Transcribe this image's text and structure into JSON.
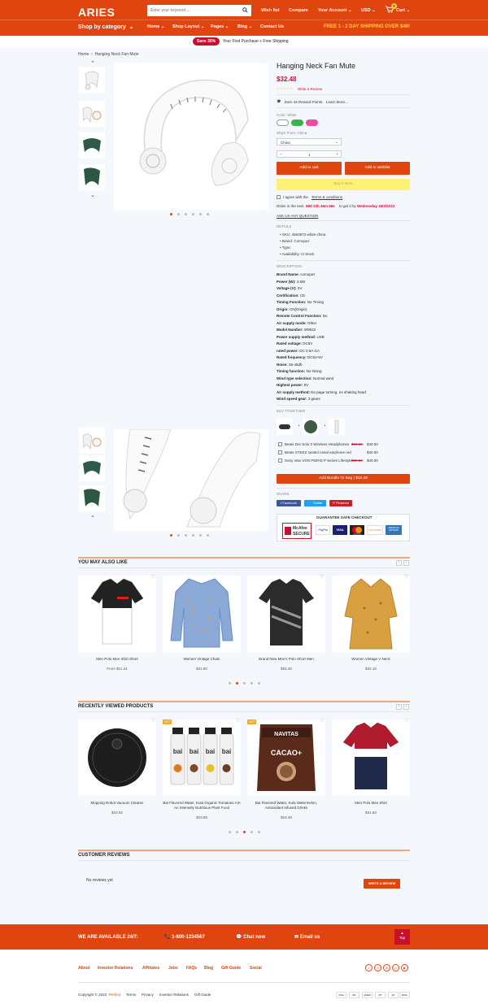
{
  "header": {
    "logo": "ARIES",
    "search_placeholder": "Enter your keyword ...",
    "wishlist": "Wish list",
    "compare": "Compare",
    "account": "Your Account",
    "currency": "USD",
    "cart": "Cart",
    "cart_count": "0",
    "shop_by_category": "Shop by category",
    "nav": [
      "Home",
      "Shop Layout",
      "Pages",
      "Blog",
      "Contact Us"
    ],
    "shipping": "FREE 1 - 2 DAY SHIPPING OVER $49!"
  },
  "promo": {
    "badge": "Save 30%",
    "text": "Your First Purchase + Free Shipping"
  },
  "breadcrumb": {
    "home": "Home",
    "current": "Hanging Neck Fan Mute"
  },
  "product": {
    "title": "Hanging Neck Fan Mute",
    "price": "$32.48",
    "review_link": "Write a Review",
    "reward": "Earn 16 Reward Points.",
    "learn_more": "Learn More...",
    "color_label": "Color: White",
    "ships_label": "Ships From: China",
    "ships_value": "China",
    "qty": "1",
    "add_to_cart": "Add to cart",
    "add_to_wishlist": "Add to wishlist",
    "buy_now": "Buy it Now",
    "agree_text": "I agree with the",
    "terms": "Terms & conditions",
    "order_prefix": "Order in the next",
    "countdown": "58d 23h 46m 56s",
    "order_mid": "to get it by",
    "delivery": "Wednesday 16/3/2022",
    "ask": "ASK US ANY QUESTION",
    "details_title": "DETAILS",
    "details": [
      "SKU: 4563972-white-china",
      "Brand: Comopez",
      "Type:",
      "Availability: In Stock"
    ],
    "description_title": "DESCRIPTION",
    "specs": [
      {
        "k": "Brand Name:",
        "v": "comopez"
      },
      {
        "k": "Power (W):",
        "v": "4.5W"
      },
      {
        "k": "Voltage (V):",
        "v": "5V"
      },
      {
        "k": "Certification:",
        "v": "CE"
      },
      {
        "k": "Timing Function:",
        "v": "No Timing"
      },
      {
        "k": "Origin:",
        "v": "CN(Origin)"
      },
      {
        "k": "Remote Control Function:",
        "v": "No"
      },
      {
        "k": "Air supply mode:",
        "v": "Other"
      },
      {
        "k": "Model Number:",
        "v": "W9042"
      },
      {
        "k": "Power supply method:",
        "v": "USB"
      },
      {
        "k": "Rated voltage:",
        "v": "DC5V"
      },
      {
        "k": "rated power:",
        "v": "DC 0.5A /1A"
      },
      {
        "k": "Rated frequency:",
        "v": "DC5V-5V"
      },
      {
        "k": "Noise:",
        "v": "36-45db"
      },
      {
        "k": "Timing function:",
        "v": "No timing"
      },
      {
        "k": "Wind type selection:",
        "v": "Normal wind"
      },
      {
        "k": "Highest power:",
        "v": "5V"
      },
      {
        "k": "Air supply method:",
        "v": "No page turning, no shaking head"
      },
      {
        "k": "Wind speed gear:",
        "v": "3 gears"
      }
    ],
    "buy_together_title": "BUY TOGETHER",
    "bundle": [
      {
        "name": "Beats Dre Solo 2 Wireless Headphones",
        "old": "$50.00",
        "new": "$40.00"
      },
      {
        "name": "Beats STEEZ sealed canal earphone red",
        "old": "",
        "new": "$40.00"
      },
      {
        "name": "Sony Vaio VGN P50HS P Series Lifestyle",
        "old": "$50.00",
        "new": "$40.00"
      }
    ],
    "bundle_button": "Add Bundle To Bag | $32.48",
    "share_title": "SHARE",
    "share": [
      "Facebook",
      "Twitter",
      "Pinterest"
    ],
    "guarantee": "GUARANTEE SAFE CHECKOUT",
    "mcafee_1": "McAfee",
    "mcafee_2": "SECURE",
    "payments": [
      "PayPal",
      "VISA",
      "mastercard",
      "DISCOVER",
      "AMERICAN EXPRESS"
    ]
  },
  "also_like": {
    "title": "YOU MAY ALSO LIKE",
    "items": [
      {
        "name": "Men Polo Men Shirt Short",
        "price": "From $11.24"
      },
      {
        "name": "Women Vintage Chain",
        "price": "$24.80"
      },
      {
        "name": "Brand New Men's Polo Short Men",
        "price": "$25.36"
      },
      {
        "name": "Women Vintage V Neck",
        "price": "$32.18"
      }
    ]
  },
  "recent": {
    "title": "RECENTLY VIEWED PRODUCTS",
    "hot": "HOT",
    "items": [
      {
        "name": "Mopping Robot Vacuum Cleaner",
        "price": "$33.92"
      },
      {
        "name": "Bai Flavored Water, Kula Organic Tomatoes Are An Intensely Nutritious Plant Food",
        "price": "$23.85"
      },
      {
        "name": "Bai Flavored Water, Kula Watermelon, Antioxidant Infused Drinks",
        "price": "$19.48"
      },
      {
        "name": "Men Polo Men Shirt",
        "price": "$31.82"
      }
    ],
    "navitas": "NAVITAS",
    "cacao": "CACAO+",
    "bai": "bai"
  },
  "reviews": {
    "title": "CUSTOMER REVIEWS",
    "empty": "No reviews yet",
    "button": "WRITE A REVIEW"
  },
  "footer": {
    "available": "WE ARE AVAILABLE 24/7:",
    "phone": "1-800-1234567",
    "chat": "Chat now",
    "email": "Email us",
    "top": "Top",
    "links": [
      "About",
      "Investor Relations",
      "Affiliates",
      "Jobs",
      "FAQs",
      "Blog",
      "Gift Guide",
      "Social"
    ],
    "copyright_prefix": "Copyright © 2022",
    "brand": "Perfect",
    "bottom_links": [
      "Terms",
      "Privacy",
      "Investor Relations",
      "Gift Guide"
    ],
    "payments": [
      "VISA",
      "MC",
      "AMEX",
      "PP",
      "AP",
      "DISC"
    ]
  },
  "colors": {
    "accent": "#e0450f",
    "yellow": "#fbd23d",
    "price": "#c8102e",
    "buy_now": "#fff176"
  }
}
